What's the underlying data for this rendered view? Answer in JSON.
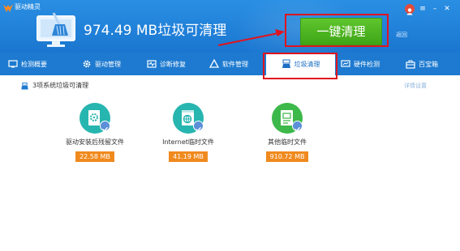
{
  "app": {
    "title": "驱动精灵"
  },
  "header": {
    "trash_size": "974.49 MB垃圾可清理",
    "clean_button": "一键清理",
    "back_link": "返回"
  },
  "tabs": [
    {
      "label": "检测概要",
      "icon": "monitor-icon",
      "active": false
    },
    {
      "label": "驱动管理",
      "icon": "gear-icon",
      "active": false
    },
    {
      "label": "诊断修复",
      "icon": "diagnose-icon",
      "active": false
    },
    {
      "label": "软件管理",
      "icon": "software-icon",
      "active": false
    },
    {
      "label": "垃圾清理",
      "icon": "broom-icon",
      "active": true
    },
    {
      "label": "硬件检测",
      "icon": "hardware-icon",
      "active": false
    },
    {
      "label": "百宝箱",
      "icon": "toolbox-icon",
      "active": false
    }
  ],
  "content": {
    "summary": "3项系统垃圾可清理",
    "settings_link": "详情设置",
    "items": [
      {
        "label": "驱动安装后残留文件",
        "size": "22.58 MB",
        "color": "#27b5b0",
        "icon": "driver-residue-icon"
      },
      {
        "label": "Internet临时文件",
        "size": "41.19 MB",
        "color": "#27b5b0",
        "icon": "internet-temp-icon"
      },
      {
        "label": "其他临时文件",
        "size": "910.72 MB",
        "color": "#3db84a",
        "icon": "other-temp-icon"
      }
    ]
  },
  "colors": {
    "header": "#1a76d0",
    "button_green": "#4db321",
    "size_badge": "#f08a1e",
    "highlight_red": "#e0141e"
  }
}
